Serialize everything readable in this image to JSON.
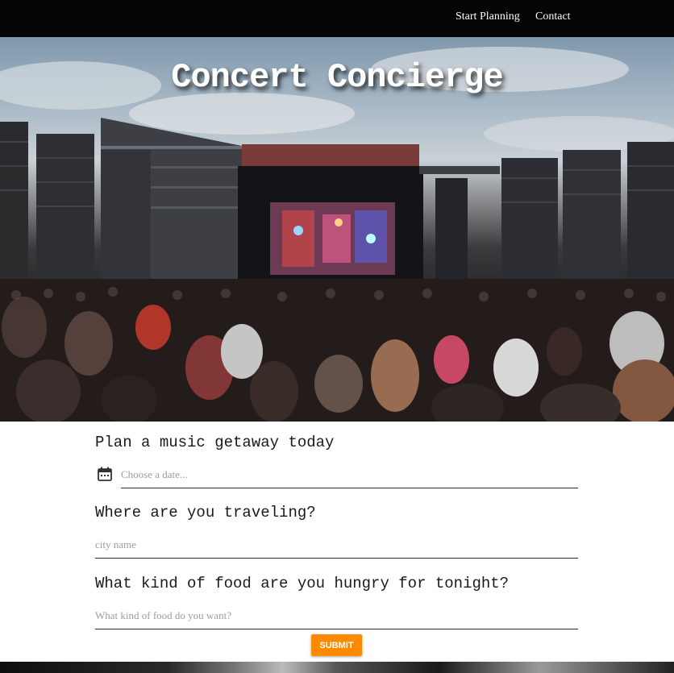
{
  "nav": {
    "start_planning": "Start Planning",
    "contact": "Contact"
  },
  "hero": {
    "title": "Concert Concierge",
    "image_alt_icon": "concert-crowd-photo"
  },
  "form": {
    "q1": "Plan a music getaway today",
    "date_placeholder": "Choose a date...",
    "q2": "Where are you traveling?",
    "city_placeholder": "city name",
    "q3": "What kind of food are you hungry for tonight?",
    "food_placeholder": "What kind of food do you want?",
    "submit": "SUBMIT"
  },
  "colors": {
    "nav_bg": "#050505",
    "submit_bg": "#ff8a00",
    "text": "#1a1a1a"
  }
}
